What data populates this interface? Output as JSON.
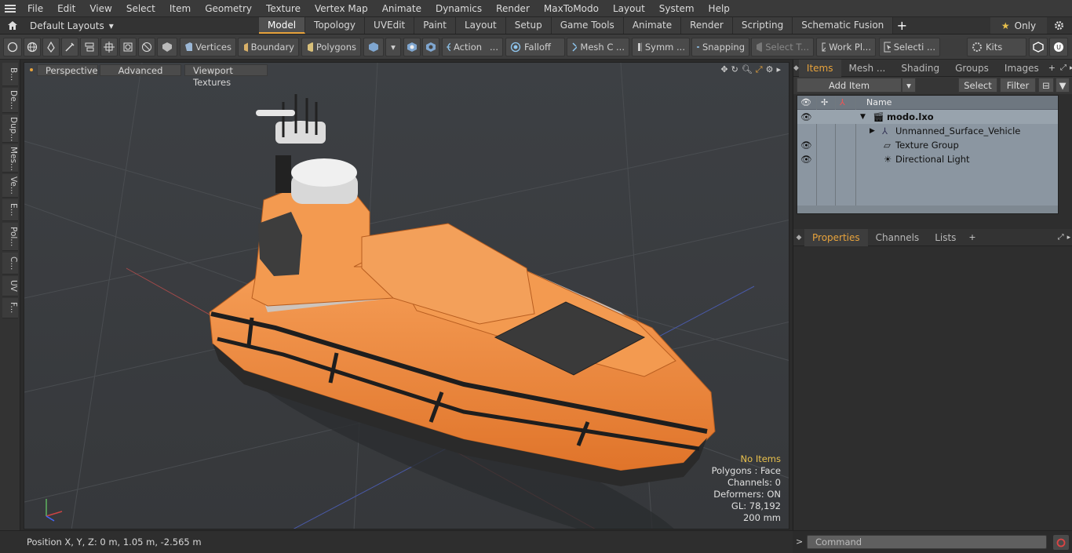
{
  "menu": [
    "File",
    "Edit",
    "View",
    "Select",
    "Item",
    "Geometry",
    "Texture",
    "Vertex Map",
    "Animate",
    "Dynamics",
    "Render",
    "MaxToModo",
    "Layout",
    "System",
    "Help"
  ],
  "layout_selector": "Default Layouts",
  "tabs": [
    "Model",
    "Topology",
    "UVEdit",
    "Paint",
    "Layout",
    "Setup",
    "Game Tools",
    "Animate",
    "Render",
    "Scripting",
    "Schematic Fusion"
  ],
  "only_label": "Only",
  "toolbar": {
    "vertices": "Vertices",
    "boundary": "Boundary",
    "polygons": "Polygons",
    "action": "Action",
    "falloff": "Falloff",
    "mesh": "Mesh C ...",
    "symm": "Symm ...",
    "snapping": "Snapping",
    "select_t": "Select T...",
    "workpl": "Work Pl...",
    "selecti": "Selecti ...",
    "kits": "Kits"
  },
  "left_tabs": [
    "B...",
    "De...",
    "Dup...",
    "Mes...",
    "Ve...",
    "E...",
    "Pol...",
    "C...",
    "UV",
    "F..."
  ],
  "viewport": {
    "perspective": "Perspective",
    "advanced": "Advanced",
    "textures": "Viewport Textures",
    "stats": {
      "no_items": "No Items",
      "polygons": "Polygons : Face",
      "channels": "Channels: 0",
      "deformers": "Deformers: ON",
      "gl": "GL: 78,192",
      "scale": "200 mm"
    }
  },
  "status": {
    "position": "Position X, Y, Z:  0 m, 1.05 m, -2.565 m"
  },
  "panel_top": {
    "tabs": [
      "Items",
      "Mesh ...",
      "Shading",
      "Groups",
      "Images"
    ],
    "add_item": "Add Item",
    "select": "Select",
    "filter": "Filter",
    "name_header": "Name",
    "tree": [
      {
        "label": "modo.lxo"
      },
      {
        "label": "Unmanned_Surface_Vehicle"
      },
      {
        "label": "Texture Group"
      },
      {
        "label": "Directional Light"
      }
    ]
  },
  "panel_bottom": {
    "tabs": [
      "Properties",
      "Channels",
      "Lists"
    ]
  },
  "command": {
    "placeholder": "Command"
  },
  "colors": {
    "accent": "#e8a33c",
    "hull": "#f08a3a",
    "tree_bg": "#8b96a1"
  }
}
